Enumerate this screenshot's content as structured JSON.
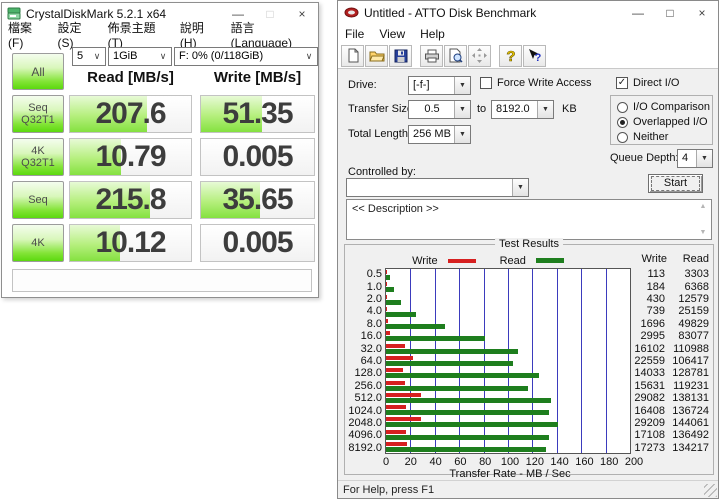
{
  "icons": {
    "chevron": "∨",
    "dropdown": "▼",
    "check": "✓",
    "minimize": "—",
    "maximize": "□",
    "close": "×",
    "scroll_up": "▲",
    "scroll_down": "▼"
  },
  "cdm": {
    "title": "CrystalDiskMark 5.2.1 x64",
    "menu": [
      "檔案(F)",
      "設定(S)",
      "佈景主題(T)",
      "說明(H)",
      "語言(Language)"
    ],
    "combos": {
      "runs": "5",
      "size": "1GiB",
      "drive": "F: 0% (0/118GiB)"
    },
    "all_label": "All",
    "headers": {
      "read": "Read [MB/s]",
      "write": "Write [MB/s]"
    },
    "rows": [
      {
        "label_lines": [
          "Seq",
          "Q32T1"
        ],
        "read": "207.6",
        "write": "51.35",
        "read_fill": 64,
        "write_fill": 54
      },
      {
        "label_lines": [
          "4K",
          "Q32T1"
        ],
        "read": "10.79",
        "write": "0.005",
        "read_fill": 42,
        "write_fill": 0
      },
      {
        "label_lines": [
          "Seq"
        ],
        "read": "215.8",
        "write": "35.65",
        "read_fill": 66,
        "write_fill": 52
      },
      {
        "label_lines": [
          "4K"
        ],
        "read": "10.12",
        "write": "0.005",
        "read_fill": 41,
        "write_fill": 0
      }
    ]
  },
  "atto": {
    "title": "Untitled - ATTO Disk Benchmark",
    "menu": [
      "File",
      "View",
      "Help"
    ],
    "toolbar_icons": [
      "new-document-icon",
      "open-folder-icon",
      "save-icon",
      "print-icon",
      "print-preview-icon",
      "pan-icon",
      "help-icon",
      "context-help-icon"
    ],
    "form": {
      "drive_label": "Drive:",
      "drive_value": "[-f-]",
      "force_write_label": "Force Write Access",
      "force_write_checked": false,
      "direct_io_label": "Direct I/O",
      "direct_io_checked": true,
      "radio_options": [
        "I/O Comparison",
        "Overlapped I/O",
        "Neither"
      ],
      "radio_selected": "Overlapped I/O",
      "transfer_size_label": "Transfer Size:",
      "transfer_from": "0.5",
      "to_label": "to",
      "transfer_to": "8192.0",
      "kb_label": "KB",
      "total_length_label": "Total Length:",
      "total_length_value": "256 MB",
      "queue_depth_label": "Queue Depth:",
      "queue_depth_value": "4",
      "controlled_by_label": "Controlled by:",
      "controlled_by_value": "",
      "start_label": "Start",
      "description_text": "<< Description >>"
    },
    "results": {
      "group_title": "Test Results",
      "legend": {
        "write": "Write",
        "read": "Read"
      },
      "col_headers": {
        "write": "Write",
        "read": "Read"
      }
    },
    "status_bar": "For Help, press F1"
  },
  "chart_data": {
    "type": "bar",
    "orientation": "horizontal",
    "title": "Test Results",
    "categories": [
      "0.5",
      "1.0",
      "2.0",
      "4.0",
      "8.0",
      "16.0",
      "32.0",
      "64.0",
      "128.0",
      "256.0",
      "512.0",
      "1024.0",
      "2048.0",
      "4096.0",
      "8192.0"
    ],
    "series": [
      {
        "name": "Write",
        "color": "#d62020",
        "values": [
          113,
          184,
          430,
          739,
          1696,
          2995,
          16102,
          22559,
          14033,
          15631,
          29082,
          16408,
          29209,
          17108,
          17273
        ]
      },
      {
        "name": "Read",
        "color": "#1e7e1e",
        "values": [
          3303,
          6368,
          12579,
          25159,
          49829,
          83077,
          110988,
          106417,
          128781,
          119231,
          138131,
          136724,
          144061,
          136492,
          134217
        ]
      }
    ],
    "values_unit": "KB/s",
    "xlabel": "Transfer Rate - MB / Sec",
    "xlim": [
      0,
      200
    ],
    "xticks": [
      "0",
      "20",
      "40",
      "60",
      "80",
      "100",
      "120",
      "140",
      "160",
      "180",
      "200"
    ],
    "grid": "vertical-blue",
    "legend_position": "top"
  }
}
